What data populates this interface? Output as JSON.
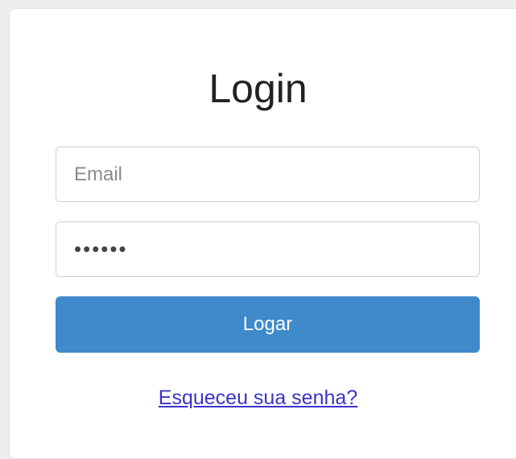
{
  "login": {
    "title": "Login",
    "email_placeholder": "Email",
    "email_value": "",
    "password_value": "••••••",
    "submit_label": "Logar",
    "forgot_link": "Esqueceu sua senha?"
  },
  "colors": {
    "button": "#3f8acb",
    "link": "#3a34c8"
  }
}
